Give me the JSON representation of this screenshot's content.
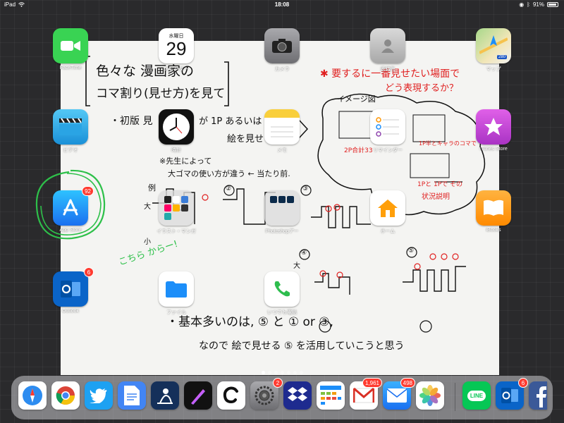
{
  "status_bar": {
    "device": "iPad",
    "time": "18:08",
    "battery": "91%",
    "battery_level": 0.91
  },
  "note": {
    "lines": [
      "色々な 漫画家の",
      "コマ割り(見せ方)を見て",
      "・初版 見",
      "が 1P あるいは",
      "絵を見せてい",
      "※先生によって",
      "大ゴマの使い方が違う ← 当たり前.",
      "例",
      "大",
      "小",
      "大",
      "・基本多いのは, ⑤ と ① or ③,",
      "なので 絵で見せる ⑤ を活用していこうと思う"
    ],
    "red_lines": [
      "✱ 要するに一番見せたい場面で",
      "どう表現するか？",
      "2P合計33",
      "1P半とキャラのコマで",
      "1Pと 1Pで その",
      "状況説明"
    ],
    "image_caption": "イメージ図",
    "marker_labels": [
      "①",
      "②",
      "③",
      "④",
      "⑤"
    ],
    "green_note": "こちら からー!"
  },
  "apps": [
    {
      "label": "FaceTime",
      "icon": "facetime-icon",
      "color": "#39d353"
    },
    {
      "label": "カレンダー",
      "icon": "calendar-icon",
      "color": "#ffffff",
      "weekday": "水曜日",
      "day": "29"
    },
    {
      "label": "カメラ",
      "icon": "camera-icon",
      "color": "#8e8e93"
    },
    {
      "label": "連絡先",
      "icon": "contacts-icon",
      "color": "#b8b8b8"
    },
    {
      "label": "マップ",
      "icon": "maps-icon",
      "color": "#f2e6b8",
      "sign": "280"
    },
    {
      "label": "ビデオ",
      "icon": "videos-icon",
      "color": "#27a9e1"
    },
    {
      "label": "時計",
      "icon": "clock-icon",
      "color": "#111111"
    },
    {
      "label": "メモ",
      "icon": "notes-icon",
      "color": "#ffffff"
    },
    {
      "label": "リマインダー",
      "icon": "reminders-icon",
      "color": "#ffffff"
    },
    {
      "label": "iTunes Store",
      "icon": "itunes-icon",
      "color": "#c645d6"
    },
    {
      "label": "App Store",
      "icon": "appstore-icon",
      "color": "#1c8ef9",
      "badge": "92"
    },
    {
      "label": "イラスト・マンガ",
      "icon": "folder-icon",
      "color": "#d8d8d8"
    },
    {
      "label": "Photoshopアー",
      "icon": "folder-icon",
      "color": "#d8d8d8"
    },
    {
      "label": "ホーム",
      "icon": "home-icon",
      "color": "#ffffff"
    },
    {
      "label": "iBooks",
      "icon": "ibooks-icon",
      "color": "#ff9500"
    },
    {
      "label": "Outlook",
      "icon": "outlook-icon",
      "color": "#0a64c8",
      "badge": "6"
    },
    {
      "label": "ファイル",
      "icon": "files-icon",
      "color": "#ffffff"
    },
    {
      "label": "いつでも電話",
      "icon": "phone-icon",
      "color": "#ffffff"
    }
  ],
  "dock": [
    {
      "name": "safari",
      "icon": "safari-icon",
      "color": "#ffffff"
    },
    {
      "name": "chrome",
      "icon": "chrome-icon",
      "color": "#ffffff"
    },
    {
      "name": "twitter",
      "icon": "twitter-icon",
      "color": "#1da1f2"
    },
    {
      "name": "docs",
      "icon": "docs-icon",
      "color": "#4285f4"
    },
    {
      "name": "kindle",
      "icon": "kindle-icon",
      "color": "#15305a"
    },
    {
      "name": "procreate",
      "icon": "procreate-icon",
      "color": "#222222"
    },
    {
      "name": "clip-studio",
      "icon": "clip-studio-icon",
      "color": "#ffffff"
    },
    {
      "name": "settings",
      "icon": "settings-icon",
      "color": "#8e8e93",
      "badge": "2"
    },
    {
      "name": "dropbox",
      "icon": "dropbox-icon",
      "color": "#1e2b8f"
    },
    {
      "name": "calendar-grid",
      "icon": "calendar-grid-icon",
      "color": "#ffffff"
    },
    {
      "name": "gmail",
      "icon": "gmail-icon",
      "color": "#ffffff",
      "badge": "1,961"
    },
    {
      "name": "mail",
      "icon": "mail-icon",
      "color": "#1e90ff",
      "badge": "498"
    },
    {
      "name": "photos",
      "icon": "photos-icon",
      "color": "#ffffff"
    },
    {
      "name": "line",
      "icon": "line-icon",
      "color": "#06c755",
      "text": "LINE"
    },
    {
      "name": "outlook",
      "icon": "outlook-icon",
      "color": "#0a64c8",
      "badge": "6"
    },
    {
      "name": "facebook",
      "icon": "facebook-icon",
      "color": "#3b5998"
    }
  ],
  "page_dots": {
    "count": 7,
    "active": 0
  }
}
